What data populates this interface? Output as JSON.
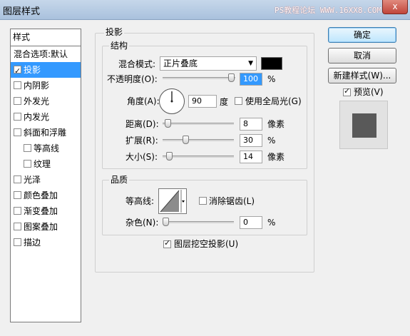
{
  "window": {
    "title": "图层样式",
    "watermark": "PS教程论坛 WWW.16XX8.COM",
    "close_glyph": "x"
  },
  "style_list": {
    "header": "样式",
    "items": [
      {
        "label": "混合选项:默认",
        "checkbox": false,
        "checked": false,
        "selected": false,
        "indent": false
      },
      {
        "label": "投影",
        "checkbox": true,
        "checked": true,
        "selected": true,
        "indent": false
      },
      {
        "label": "内阴影",
        "checkbox": true,
        "checked": false,
        "selected": false,
        "indent": false
      },
      {
        "label": "外发光",
        "checkbox": true,
        "checked": false,
        "selected": false,
        "indent": false
      },
      {
        "label": "内发光",
        "checkbox": true,
        "checked": false,
        "selected": false,
        "indent": false
      },
      {
        "label": "斜面和浮雕",
        "checkbox": true,
        "checked": false,
        "selected": false,
        "indent": false
      },
      {
        "label": "等高线",
        "checkbox": true,
        "checked": false,
        "selected": false,
        "indent": true
      },
      {
        "label": "纹理",
        "checkbox": true,
        "checked": false,
        "selected": false,
        "indent": true
      },
      {
        "label": "光泽",
        "checkbox": true,
        "checked": false,
        "selected": false,
        "indent": false
      },
      {
        "label": "颜色叠加",
        "checkbox": true,
        "checked": false,
        "selected": false,
        "indent": false
      },
      {
        "label": "渐变叠加",
        "checkbox": true,
        "checked": false,
        "selected": false,
        "indent": false
      },
      {
        "label": "图案叠加",
        "checkbox": true,
        "checked": false,
        "selected": false,
        "indent": false
      },
      {
        "label": "描边",
        "checkbox": true,
        "checked": false,
        "selected": false,
        "indent": false
      }
    ]
  },
  "drop_shadow": {
    "title": "投影",
    "structure": {
      "title": "结构",
      "blend_mode_label": "混合模式:",
      "blend_mode_value": "正片叠底",
      "blend_color": "#000000",
      "opacity_label": "不透明度(O):",
      "opacity_value": "100",
      "opacity_unit": "%",
      "opacity_level": 1.0,
      "angle_label": "角度(A):",
      "angle_value": "90",
      "angle_unit": "度",
      "angle_degrees": 90,
      "global_light_label": "使用全局光(G)",
      "global_light_checked": false,
      "distance_label": "距离(D):",
      "distance_value": "8",
      "distance_unit": "像素",
      "distance_level": 0.03,
      "spread_label": "扩展(R):",
      "spread_value": "30",
      "spread_unit": "%",
      "spread_level": 0.3,
      "size_label": "大小(S):",
      "size_value": "14",
      "size_unit": "像素",
      "size_level": 0.056
    },
    "quality": {
      "title": "品质",
      "contour_label": "等高线:",
      "anti_alias_label": "消除锯齿(L)",
      "anti_alias_checked": false,
      "noise_label": "杂色(N):",
      "noise_value": "0",
      "noise_unit": "%",
      "noise_level": 0.0
    },
    "knockout_label": "图层挖空投影(U)",
    "knockout_checked": true
  },
  "buttons": {
    "ok": "确定",
    "cancel": "取消",
    "new_style": "新建样式(W)...",
    "preview_label": "预览(V)",
    "preview_checked": true
  },
  "colors": {
    "selection": "#3399ff",
    "preview_bg": "#e2e2e2",
    "preview_square": "#595959"
  }
}
